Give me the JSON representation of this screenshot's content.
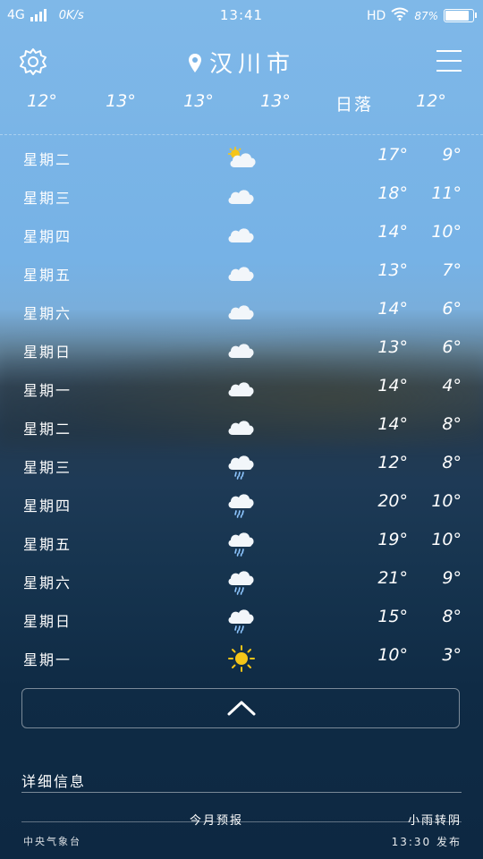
{
  "status_bar": {
    "network": "4G",
    "speed": "0K/s",
    "time": "13:41",
    "hd": "HD",
    "battery_text": "87%",
    "battery_level": 0.87
  },
  "header": {
    "city": "汉川市",
    "settings_icon": "gear-icon",
    "location_icon": "location-pin-icon",
    "menu_icon": "menu-icon"
  },
  "hourly": [
    "12°",
    "13°",
    "13°",
    "13°",
    "日落",
    "12°"
  ],
  "days": [
    {
      "day": "星期二",
      "icon": "partly-cloudy",
      "hi": "17°",
      "lo": "9°"
    },
    {
      "day": "星期三",
      "icon": "cloudy",
      "hi": "18°",
      "lo": "11°"
    },
    {
      "day": "星期四",
      "icon": "cloudy",
      "hi": "14°",
      "lo": "10°"
    },
    {
      "day": "星期五",
      "icon": "cloudy",
      "hi": "13°",
      "lo": "7°"
    },
    {
      "day": "星期六",
      "icon": "cloudy",
      "hi": "14°",
      "lo": "6°"
    },
    {
      "day": "星期日",
      "icon": "cloudy",
      "hi": "13°",
      "lo": "6°"
    },
    {
      "day": "星期一",
      "icon": "cloudy",
      "hi": "14°",
      "lo": "4°"
    },
    {
      "day": "星期二",
      "icon": "cloudy",
      "hi": "14°",
      "lo": "8°"
    },
    {
      "day": "星期三",
      "icon": "rain",
      "hi": "12°",
      "lo": "8°"
    },
    {
      "day": "星期四",
      "icon": "rain",
      "hi": "20°",
      "lo": "10°"
    },
    {
      "day": "星期五",
      "icon": "rain",
      "hi": "19°",
      "lo": "10°"
    },
    {
      "day": "星期六",
      "icon": "rain",
      "hi": "21°",
      "lo": "9°"
    },
    {
      "day": "星期日",
      "icon": "rain",
      "hi": "15°",
      "lo": "8°"
    },
    {
      "day": "星期一",
      "icon": "sunny",
      "hi": "10°",
      "lo": "3°"
    }
  ],
  "collapse_icon": "chevron-up-icon",
  "details": {
    "title": "详细信息",
    "monthly_forecast": "今月预报",
    "weather_text": "小雨转阴",
    "source": "中央气象台",
    "publish_time": "13:30 发布"
  },
  "colors": {
    "sky_top": "#7fb8e8",
    "sky_bottom": "#0d2842",
    "cloud": "#f2f6fa",
    "sun": "#f5c518",
    "rain": "#8ec6ff"
  }
}
